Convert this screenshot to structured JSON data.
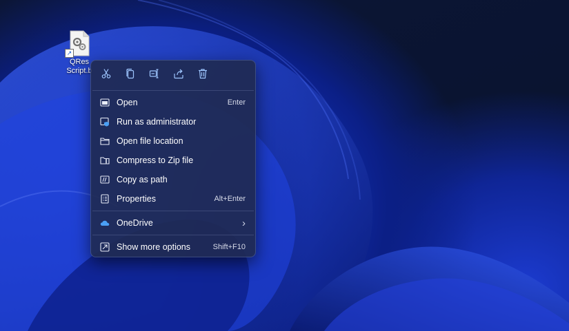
{
  "desktop": {
    "shortcut_icon": {
      "icon": "batch-file-gears-icon",
      "label_line1": "QRes",
      "label_line2": "Script.b"
    }
  },
  "context_menu": {
    "actions": [
      {
        "name": "cut",
        "icon": "scissors-icon"
      },
      {
        "name": "copy",
        "icon": "copy-icon"
      },
      {
        "name": "rename",
        "icon": "rename-icon"
      },
      {
        "name": "share",
        "icon": "share-icon"
      },
      {
        "name": "delete",
        "icon": "trash-icon"
      }
    ],
    "items": [
      {
        "label": "Open",
        "shortcut": "Enter",
        "icon": "open-window-icon"
      },
      {
        "label": "Run as administrator",
        "shortcut": "",
        "icon": "shield-window-icon"
      },
      {
        "label": "Open file location",
        "shortcut": "",
        "icon": "folder-icon"
      },
      {
        "label": "Compress to Zip file",
        "shortcut": "",
        "icon": "zip-folder-icon"
      },
      {
        "label": "Copy as path",
        "shortcut": "",
        "icon": "copy-path-icon"
      },
      {
        "label": "Properties",
        "shortcut": "Alt+Enter",
        "icon": "properties-icon"
      },
      {
        "label": "OneDrive",
        "shortcut": "",
        "icon": "onedrive-cloud-icon",
        "submenu": true
      },
      {
        "label": "Show more options",
        "shortcut": "Shift+F10",
        "icon": "show-more-icon"
      }
    ]
  },
  "colors": {
    "menu_bg": "#1f2a52",
    "accent": "#4a9ff5",
    "text": "#ffffff"
  }
}
